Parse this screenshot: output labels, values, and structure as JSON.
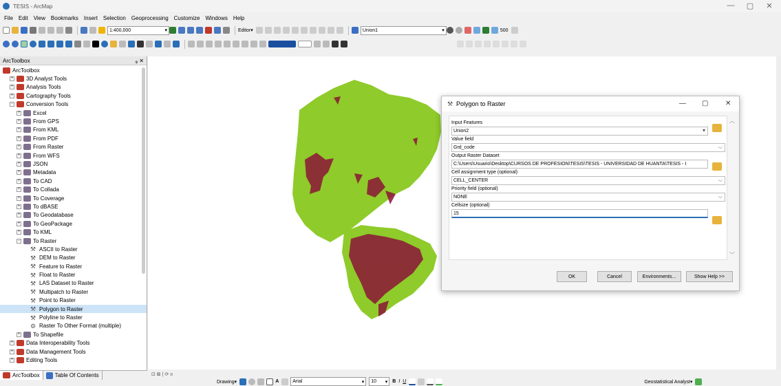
{
  "window": {
    "title": "TESIS - ArcMap",
    "minimize": "—",
    "maximize": "▢",
    "close": "✕"
  },
  "menu": [
    "File",
    "Edit",
    "View",
    "Bookmarks",
    "Insert",
    "Selection",
    "Geoprocessing",
    "Customize",
    "Windows",
    "Help"
  ],
  "toolbar": {
    "scale": "1:400,000",
    "editor": "Editor▾",
    "layer_combo": "Union1",
    "cell_value": "500"
  },
  "toolbox": {
    "header": "ArcToolbox",
    "pin": "ᵩ ✕",
    "items": [
      {
        "label": "ArcToolbox",
        "level": 0,
        "pm": "",
        "kind": "root"
      },
      {
        "label": "3D Analyst Tools",
        "level": 1,
        "pm": "+",
        "kind": "toolbox"
      },
      {
        "label": "Analysis Tools",
        "level": 1,
        "pm": "+",
        "kind": "toolbox"
      },
      {
        "label": "Cartography Tools",
        "level": 1,
        "pm": "+",
        "kind": "toolbox"
      },
      {
        "label": "Conversion Tools",
        "level": 1,
        "pm": "−",
        "kind": "toolbox"
      },
      {
        "label": "Excel",
        "level": 2,
        "pm": "+",
        "kind": "toolset"
      },
      {
        "label": "From GPS",
        "level": 2,
        "pm": "+",
        "kind": "toolset"
      },
      {
        "label": "From KML",
        "level": 2,
        "pm": "+",
        "kind": "toolset"
      },
      {
        "label": "From PDF",
        "level": 2,
        "pm": "+",
        "kind": "toolset"
      },
      {
        "label": "From Raster",
        "level": 2,
        "pm": "+",
        "kind": "toolset"
      },
      {
        "label": "From WFS",
        "level": 2,
        "pm": "+",
        "kind": "toolset"
      },
      {
        "label": "JSON",
        "level": 2,
        "pm": "+",
        "kind": "toolset"
      },
      {
        "label": "Metadata",
        "level": 2,
        "pm": "+",
        "kind": "toolset"
      },
      {
        "label": "To CAD",
        "level": 2,
        "pm": "+",
        "kind": "toolset"
      },
      {
        "label": "To Collada",
        "level": 2,
        "pm": "+",
        "kind": "toolset"
      },
      {
        "label": "To Coverage",
        "level": 2,
        "pm": "+",
        "kind": "toolset"
      },
      {
        "label": "To dBASE",
        "level": 2,
        "pm": "+",
        "kind": "toolset"
      },
      {
        "label": "To Geodatabase",
        "level": 2,
        "pm": "+",
        "kind": "toolset"
      },
      {
        "label": "To GeoPackage",
        "level": 2,
        "pm": "+",
        "kind": "toolset"
      },
      {
        "label": "To KML",
        "level": 2,
        "pm": "+",
        "kind": "toolset"
      },
      {
        "label": "To Raster",
        "level": 2,
        "pm": "−",
        "kind": "toolset"
      },
      {
        "label": "ASCII to Raster",
        "level": 3,
        "pm": "",
        "kind": "tool"
      },
      {
        "label": "DEM to Raster",
        "level": 3,
        "pm": "",
        "kind": "tool"
      },
      {
        "label": "Feature to Raster",
        "level": 3,
        "pm": "",
        "kind": "tool"
      },
      {
        "label": "Float to Raster",
        "level": 3,
        "pm": "",
        "kind": "tool"
      },
      {
        "label": "LAS Dataset to Raster",
        "level": 3,
        "pm": "",
        "kind": "tool"
      },
      {
        "label": "Multipatch to Raster",
        "level": 3,
        "pm": "",
        "kind": "tool"
      },
      {
        "label": "Point to Raster",
        "level": 3,
        "pm": "",
        "kind": "tool"
      },
      {
        "label": "Polygon to Raster",
        "level": 3,
        "pm": "",
        "kind": "tool",
        "selected": true
      },
      {
        "label": "Polyline to Raster",
        "level": 3,
        "pm": "",
        "kind": "tool"
      },
      {
        "label": "Raster To Other Format (multiple)",
        "level": 3,
        "pm": "",
        "kind": "script"
      },
      {
        "label": "To Shapefile",
        "level": 2,
        "pm": "+",
        "kind": "toolset"
      },
      {
        "label": "Data Interoperability Tools",
        "level": 1,
        "pm": "+",
        "kind": "toolbox"
      },
      {
        "label": "Data Management Tools",
        "level": 1,
        "pm": "+",
        "kind": "toolbox"
      },
      {
        "label": "Editing Tools",
        "level": 1,
        "pm": "+",
        "kind": "toolbox"
      }
    ]
  },
  "tabs": [
    "ArcToolbox",
    "Table Of Contents"
  ],
  "map": {
    "status": "⊡ ⊠ | ⟳ ıı",
    "colors": {
      "land": "#8fcb2a",
      "raster": "#8b1538"
    }
  },
  "drawbar": {
    "drawing": "Drawing▾",
    "font": "Arial",
    "size": "10",
    "bold": "B",
    "italic": "I",
    "underline": "U",
    "fontcolor": "A",
    "geostat": "Geostatistical Analyst▾"
  },
  "dialog": {
    "title": "Polygon to Raster",
    "input_features_label": "Input Features",
    "input_features_value": "Union2",
    "value_field_label": "Value field",
    "value_field_value": "Grd_code",
    "output_label": "Output Raster Dataset",
    "output_value": "C:\\Users\\Usuario\\Desktop\\CURSOS DE PROFESION\\TESIS\\TESIS - UNIVERSIDAD DE HUANTA\\TESIS - I",
    "cell_assign_label": "Cell assignment type (optional)",
    "cell_assign_value": "CELL_CENTER",
    "priority_label": "Priority field (optional)",
    "priority_value": "NONE",
    "cellsize_label": "Cellsize (optional)",
    "cellsize_value": "15",
    "ok": "OK",
    "cancel": "Cancel",
    "environments": "Environments...",
    "show_help": "Show Help >>"
  }
}
